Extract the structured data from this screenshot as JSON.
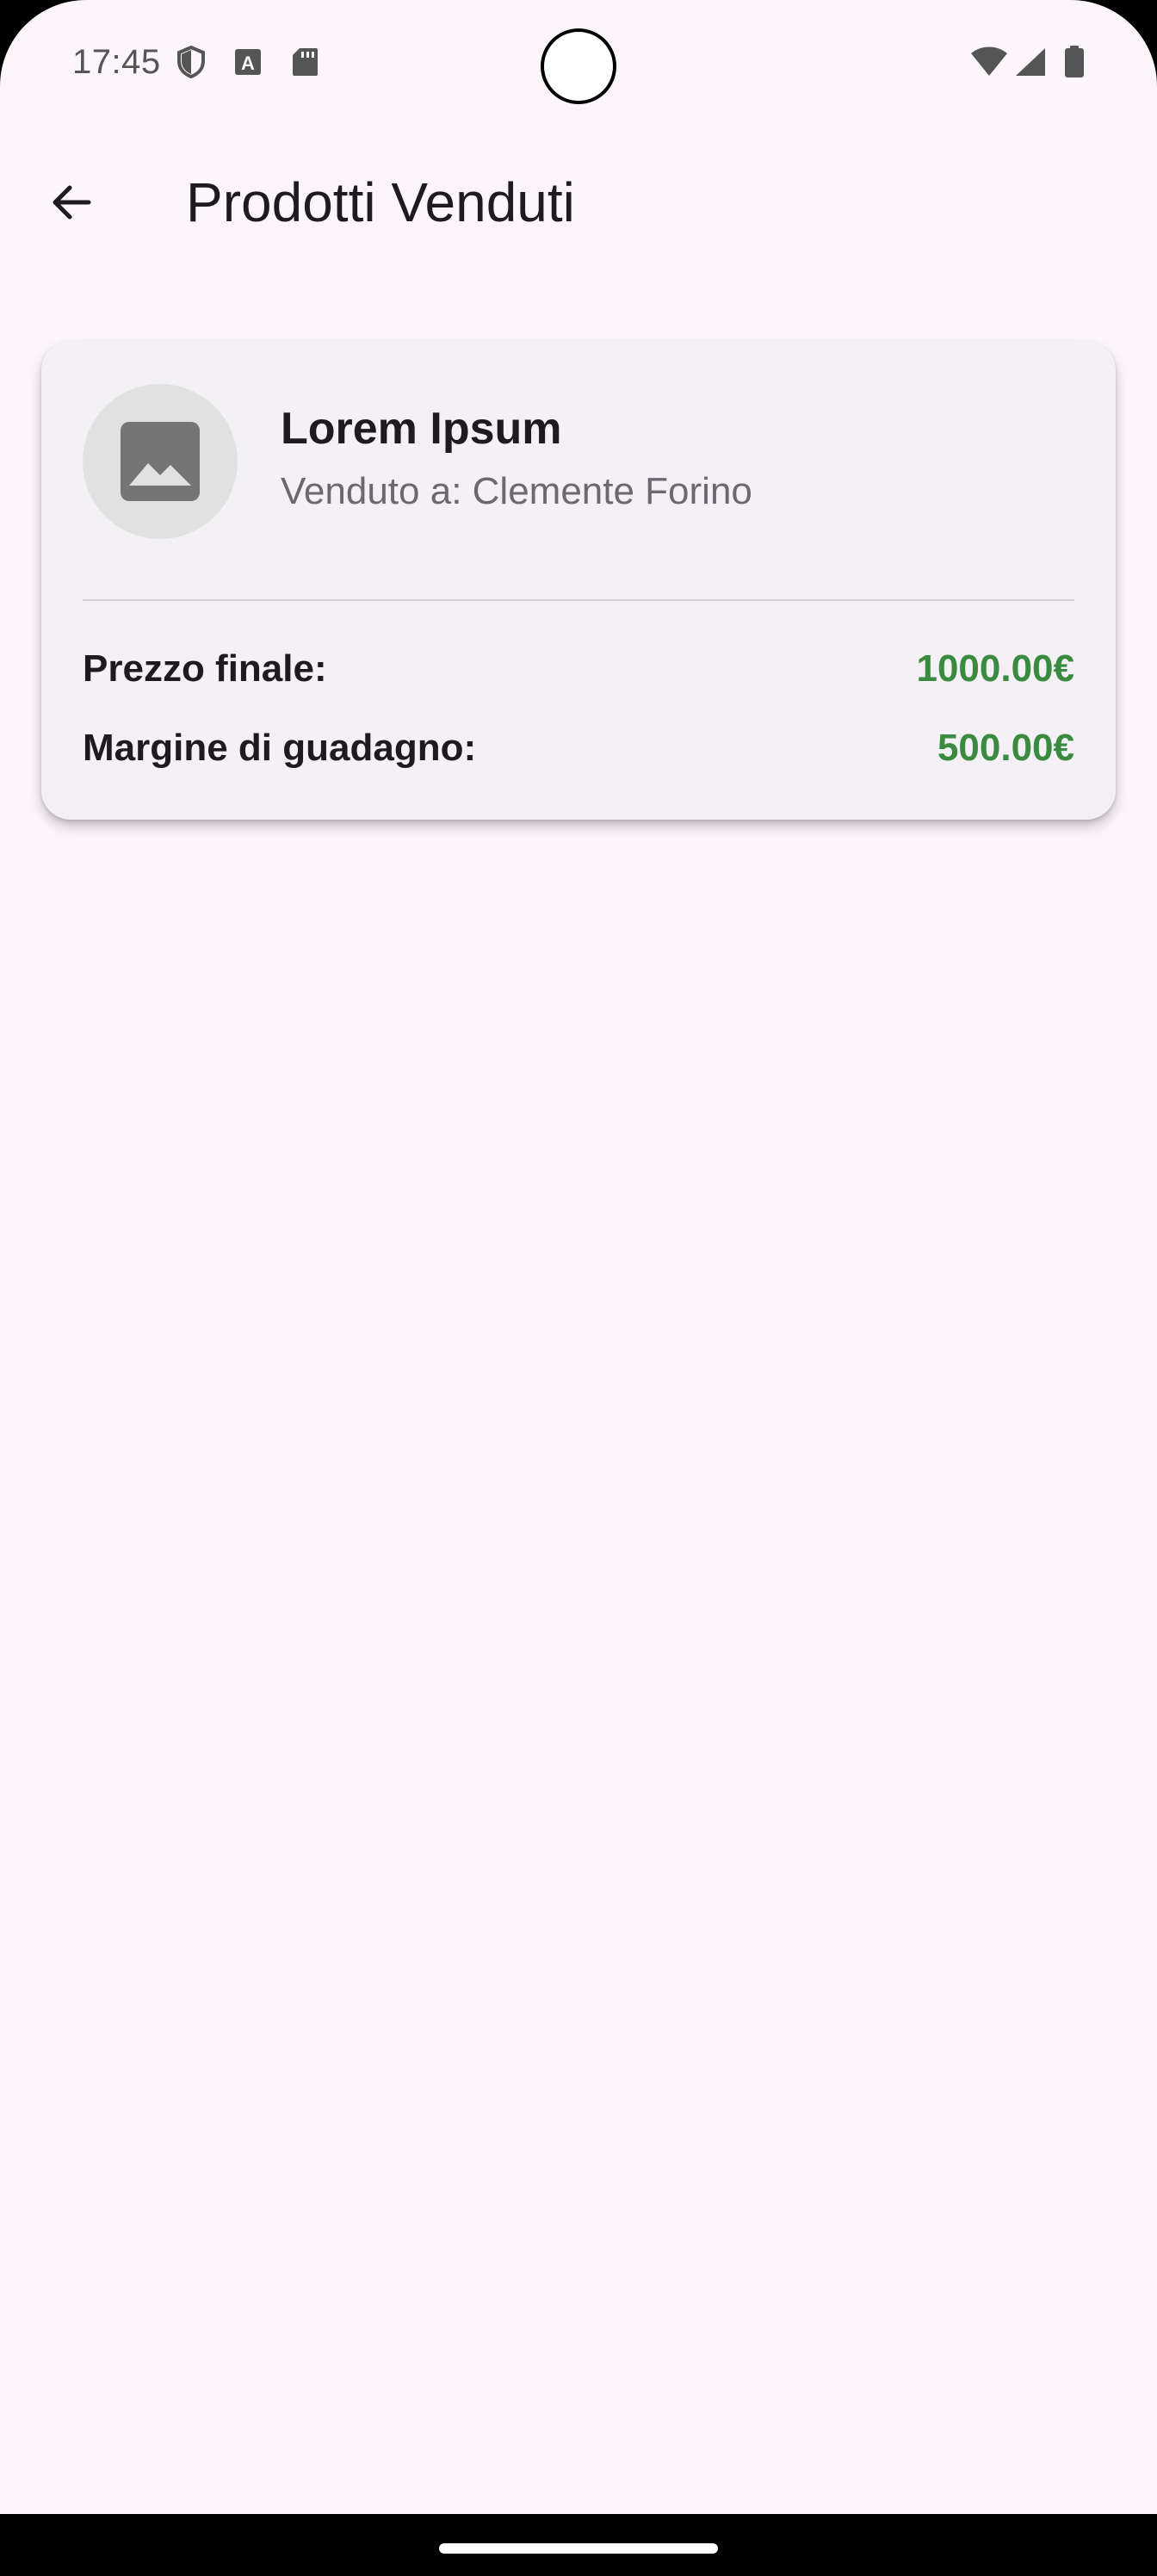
{
  "status_bar": {
    "time": "17:45",
    "left_icons": [
      "shield-icon",
      "text-a-icon",
      "sd-card-icon"
    ],
    "right_icons": [
      "wifi-icon",
      "signal-icon",
      "battery-icon"
    ]
  },
  "app_bar": {
    "back_icon": "arrow-back-icon",
    "title": "Prodotti Venduti"
  },
  "sold_products": [
    {
      "image_icon": "image-placeholder-icon",
      "name": "Lorem Ipsum",
      "buyer": "Venduto a: Clemente Forino",
      "final_price_label": "Prezzo finale:",
      "final_price_value": "1000.00€",
      "margin_label": "Margine di guadagno:",
      "margin_value": "500.00€"
    }
  ],
  "colors": {
    "background": "#FCF5FC",
    "card": "#F3F0F6",
    "price_green": "#3A8A3F",
    "text_primary": "#1D1B20",
    "text_secondary": "#6B6870"
  }
}
